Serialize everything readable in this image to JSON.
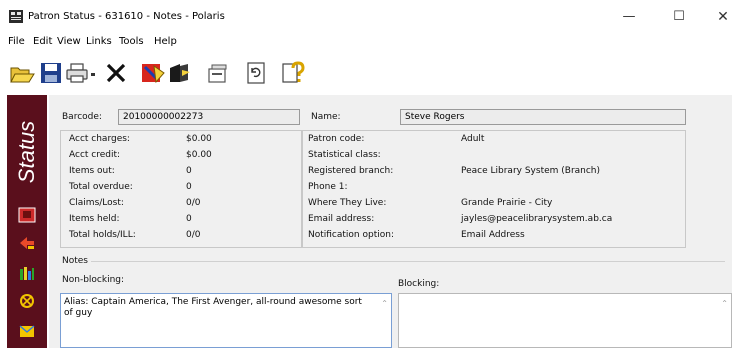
{
  "window": {
    "title": "Patron Status - 631610 - Notes - Polaris",
    "controls": {
      "minimize": "—",
      "maximize": "☐",
      "close": "✕"
    }
  },
  "menu": [
    "File",
    "Edit",
    "View",
    "Links",
    "Tools",
    "Help"
  ],
  "toolbar": [
    "open-folder-icon",
    "save-icon",
    "print-icon",
    "dropdown-arrow-icon",
    "delete-icon",
    "check-in-icon",
    "check-out-icon",
    "properties-icon",
    "refresh-icon",
    "help-icon"
  ],
  "side_panel": {
    "label": "Status",
    "icons": [
      "patron-icon",
      "check-in-arrow-icon",
      "items-icon",
      "fines-icon",
      "messages-icon"
    ]
  },
  "barcode": {
    "label": "Barcode:",
    "value": "20100000002273"
  },
  "name": {
    "label": "Name:",
    "value": "Steve Rogers"
  },
  "account": [
    {
      "label": "Acct charges:",
      "value": "$0.00"
    },
    {
      "label": "Acct credit:",
      "value": "$0.00"
    },
    {
      "label": "Items out:",
      "value": "0"
    },
    {
      "label": "Total overdue:",
      "value": "0"
    },
    {
      "label": "Claims/Lost:",
      "value": "0/0"
    },
    {
      "label": "Items held:",
      "value": "0"
    },
    {
      "label": "Total holds/ILL:",
      "value": "0/0"
    }
  ],
  "patron": [
    {
      "label": "Patron code:",
      "value": "Adult"
    },
    {
      "label": "Statistical class:",
      "value": ""
    },
    {
      "label": "Registered branch:",
      "value": "Peace Library System (Branch)"
    },
    {
      "label": "Phone 1:",
      "value": ""
    },
    {
      "label": "Where They Live:",
      "value": "Grande Prairie - City"
    },
    {
      "label": "Email address:",
      "value": "jayles@peacelibrarysystem.ab.ca"
    },
    {
      "label": "Notification option:",
      "value": "Email Address"
    }
  ],
  "notes": {
    "section_label": "Notes",
    "non_blocking_label": "Non-blocking:",
    "non_blocking_text": "Alias: Captain America, The First Avenger, all-round awesome sort of guy",
    "blocking_label": "Blocking:",
    "blocking_text": ""
  }
}
